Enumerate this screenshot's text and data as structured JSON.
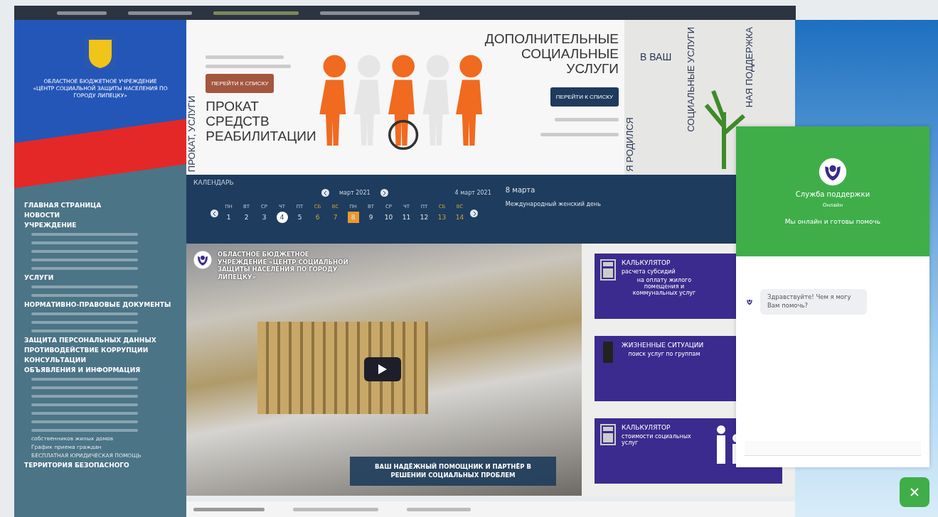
{
  "sidebar": {
    "org_name": "ОБЛАСТНОЕ БЮДЖЕТНОЕ УЧРЕЖДЕНИЕ «ЦЕНТР СОЦИАЛЬНОЙ ЗАЩИТЫ НАСЕЛЕНИЯ ПО ГОРОДУ ЛИПЕЦКУ»",
    "menu": [
      {
        "kind": "main",
        "label": "ГЛАВНАЯ СТРАНИЦА"
      },
      {
        "kind": "main",
        "label": "НОВОСТИ"
      },
      {
        "kind": "main",
        "label": "УЧРЕЖДЕНИЕ"
      },
      {
        "kind": "blurred"
      },
      {
        "kind": "blurred"
      },
      {
        "kind": "blurred"
      },
      {
        "kind": "blurred"
      },
      {
        "kind": "blurred"
      },
      {
        "kind": "main",
        "label": "УСЛУГИ"
      },
      {
        "kind": "blurred"
      },
      {
        "kind": "blurred"
      },
      {
        "kind": "main",
        "label": "НОРМАТИВНО-ПРАВОВЫЕ ДОКУМЕНТЫ"
      },
      {
        "kind": "blurred"
      },
      {
        "kind": "blurred"
      },
      {
        "kind": "blurred"
      },
      {
        "kind": "main",
        "label": "ЗАЩИТА ПЕРСОНАЛЬНЫХ ДАННЫХ"
      },
      {
        "kind": "main",
        "label": "ПРОТИВОДЕЙСТВИЕ КОРРУПЦИИ"
      },
      {
        "kind": "main",
        "label": "КОНСУЛЬТАЦИИ"
      },
      {
        "kind": "main",
        "label": "ОБЪЯВЛЕНИЯ И ИНФОРМАЦИЯ"
      },
      {
        "kind": "blurred"
      },
      {
        "kind": "blurred"
      },
      {
        "kind": "blurred"
      },
      {
        "kind": "blurred"
      },
      {
        "kind": "blurred"
      },
      {
        "kind": "blurred"
      },
      {
        "kind": "blurred"
      },
      {
        "kind": "sub",
        "label": "собственников жилых домов"
      },
      {
        "kind": "sub",
        "label": "График приема граждан"
      },
      {
        "kind": "sub",
        "label": "БЕСПЛАТНАЯ ЮРИДИЧЕСКАЯ ПОМОЩЬ"
      },
      {
        "kind": "main",
        "label": "ТЕРРИТОРИЯ БЕЗОПАСНОГО"
      }
    ]
  },
  "banner": {
    "side_label": "ПРОКАТ, УСЛУГИ",
    "left_button": "ПЕРЕЙТИ К СПИСКУ",
    "left_title": "ПРОКАТ\nСРЕДСТВ\nРЕАБИЛИТАЦИИ",
    "right_title": "ДОПОЛНИТЕЛЬНЫЕ\nСОЦИАЛЬНЫЕ\nУСЛУГИ",
    "right_button": "ПЕРЕЙТИ К СПИСКУ"
  },
  "side_banners": {
    "vertical_left": "Я РОДИЛСЯ",
    "heading": "В ВАШ",
    "vertical_middle": "СОЦИАЛЬНЫЕ УСЛУГИ",
    "vertical_right": "НАЯ ПОДДЕРЖКА"
  },
  "calendar": {
    "title": "КАЛЕНДАРЬ",
    "month": "март 2021",
    "date": "4 март 2021",
    "event_date": "8 марта",
    "event": "Международный женский день",
    "days": [
      {
        "weekday": "ПН",
        "day": "1",
        "weekend": false,
        "selected": false,
        "holiday": false
      },
      {
        "weekday": "ВТ",
        "day": "2",
        "weekend": false,
        "selected": false,
        "holiday": false
      },
      {
        "weekday": "СР",
        "day": "3",
        "weekend": false,
        "selected": false,
        "holiday": false
      },
      {
        "weekday": "ЧТ",
        "day": "4",
        "weekend": false,
        "selected": true,
        "holiday": false
      },
      {
        "weekday": "ПТ",
        "day": "5",
        "weekend": false,
        "selected": false,
        "holiday": false
      },
      {
        "weekday": "СБ",
        "day": "6",
        "weekend": true,
        "selected": false,
        "holiday": false
      },
      {
        "weekday": "ВС",
        "day": "7",
        "weekend": true,
        "selected": false,
        "holiday": false
      },
      {
        "weekday": "ПН",
        "day": "8",
        "weekend": false,
        "selected": false,
        "holiday": true
      },
      {
        "weekday": "ВТ",
        "day": "9",
        "weekend": false,
        "selected": false,
        "holiday": false
      },
      {
        "weekday": "СР",
        "day": "10",
        "weekend": false,
        "selected": false,
        "holiday": false
      },
      {
        "weekday": "ЧТ",
        "day": "11",
        "weekend": false,
        "selected": false,
        "holiday": false
      },
      {
        "weekday": "ПТ",
        "day": "12",
        "weekend": false,
        "selected": false,
        "holiday": false
      },
      {
        "weekday": "СБ",
        "day": "13",
        "weekend": true,
        "selected": false,
        "holiday": false
      },
      {
        "weekday": "ВС",
        "day": "14",
        "weekend": true,
        "selected": false,
        "holiday": false
      }
    ]
  },
  "video": {
    "title": "ОБЛАСТНОЕ БЮДЖЕТНОЕ УЧРЕЖДЕНИЕ «ЦЕНТР СОЦИАЛЬНОЙ ЗАЩИТЫ НАСЕЛЕНИЯ ПО ГОРОДУ ЛИПЕЦКУ»",
    "caption": "ВАШ НАДЁЖНЫЙ ПОМОЩНИК И ПАРТНЁР В РЕШЕНИИ СОЦИАЛЬНЫХ ПРОБЛЕМ"
  },
  "cards": [
    {
      "kind": "calculator",
      "title": "КАЛЬКУЛЯТОР",
      "subtitle": "расчета субсидий",
      "text": "на оплату жилого помещения и коммунальных услуг"
    },
    {
      "kind": "situations",
      "title": "ЖИЗНЕННЫЕ СИТУАЦИИ",
      "text": "поиск услуг по группам"
    },
    {
      "kind": "care",
      "title": "КАЛЬКУЛЯТОР",
      "subtitle": "стоимости социальных услуг"
    }
  ],
  "chat": {
    "title": "Служба поддержки",
    "status": "Онлайн",
    "tagline": "Мы онлайн и готовы помочь",
    "message": "Здравствуйте! Чем я могу Вам помочь?"
  }
}
